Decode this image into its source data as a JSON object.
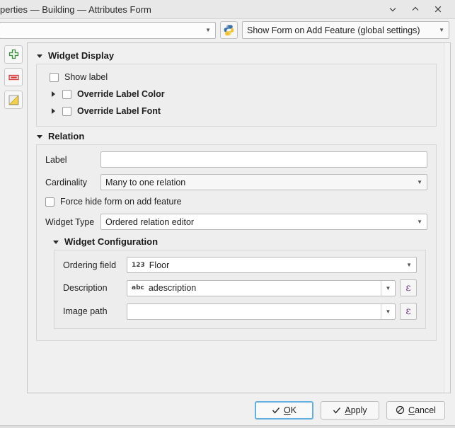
{
  "window": {
    "title": "perties — Building — Attributes Form",
    "controls": {
      "minimize": "minimize-icon",
      "maximize": "maximize-icon",
      "close": "close-icon"
    }
  },
  "toolbar": {
    "field_combo_value": "",
    "python_button_icon": "python-icon",
    "form_mode_value": "Show Form on Add Feature (global settings)"
  },
  "sidebar": {
    "buttons": [
      {
        "name": "add-item-button",
        "icon": "green-plus-icon"
      },
      {
        "name": "remove-item-button",
        "icon": "red-minus-icon"
      },
      {
        "name": "invert-selection-button",
        "icon": "yellow-triangle-icon"
      }
    ]
  },
  "widget_display": {
    "section_title": "Widget Display",
    "show_label": {
      "label": "Show label",
      "checked": false
    },
    "override_label_color": {
      "label": "Override Label Color",
      "checked": false,
      "expanded": false
    },
    "override_label_font": {
      "label": "Override Label Font",
      "checked": false,
      "expanded": false
    }
  },
  "relation": {
    "section_title": "Relation",
    "label_field": {
      "label": "Label",
      "value": ""
    },
    "cardinality": {
      "label": "Cardinality",
      "value": "Many to one relation"
    },
    "force_hide": {
      "label": "Force hide form on add feature",
      "checked": false
    },
    "widget_type": {
      "label": "Widget Type",
      "value": "Ordered relation editor"
    }
  },
  "widget_configuration": {
    "section_title": "Widget Configuration",
    "ordering_field": {
      "label": "Ordering field",
      "type_icon": "123",
      "value": "Floor"
    },
    "description": {
      "label": "Description",
      "type_icon": "abc",
      "value": "adescription",
      "expression_button": "ε"
    },
    "image_path": {
      "label": "Image path",
      "type_icon": "",
      "value": "",
      "expression_button": "ε"
    }
  },
  "footer": {
    "ok": {
      "pre": "",
      "mnemonic": "O",
      "post": "K",
      "icon": "check-icon"
    },
    "apply": {
      "pre": "",
      "mnemonic": "A",
      "post": "pply",
      "icon": "check-icon"
    },
    "cancel": {
      "pre": "",
      "mnemonic": "C",
      "post": "ancel",
      "icon": "block-icon"
    }
  }
}
